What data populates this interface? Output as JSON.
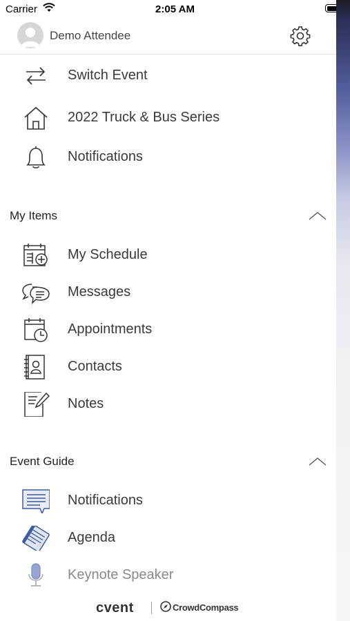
{
  "status_bar": {
    "carrier": "Carrier",
    "time": "2:05 AM"
  },
  "header": {
    "user_name": "Demo Attendee"
  },
  "top_menu": [
    {
      "label": "Switch Event",
      "icon": "switch-arrows-icon"
    },
    {
      "label": "2022 Truck & Bus Series",
      "icon": "home-icon"
    },
    {
      "label": "Notifications",
      "icon": "bell-icon"
    }
  ],
  "my_items": {
    "title": "My Items",
    "items": [
      {
        "label": "My Schedule",
        "icon": "schedule-add-icon"
      },
      {
        "label": "Messages",
        "icon": "messages-icon"
      },
      {
        "label": "Appointments",
        "icon": "appointments-icon"
      },
      {
        "label": "Contacts",
        "icon": "contacts-icon"
      },
      {
        "label": "Notes",
        "icon": "notes-icon"
      }
    ]
  },
  "event_guide": {
    "title": "Event Guide",
    "items": [
      {
        "label": "Notifications",
        "icon": "notification-card-icon"
      },
      {
        "label": "Agenda",
        "icon": "agenda-icon"
      },
      {
        "label": "Keynote Speaker",
        "icon": "microphone-icon"
      }
    ]
  },
  "footer": {
    "brand": "cvent",
    "partner": "CrowdCompass"
  },
  "colors": {
    "accent_blue": "#3f5aa3",
    "text": "#3a3a3a"
  }
}
